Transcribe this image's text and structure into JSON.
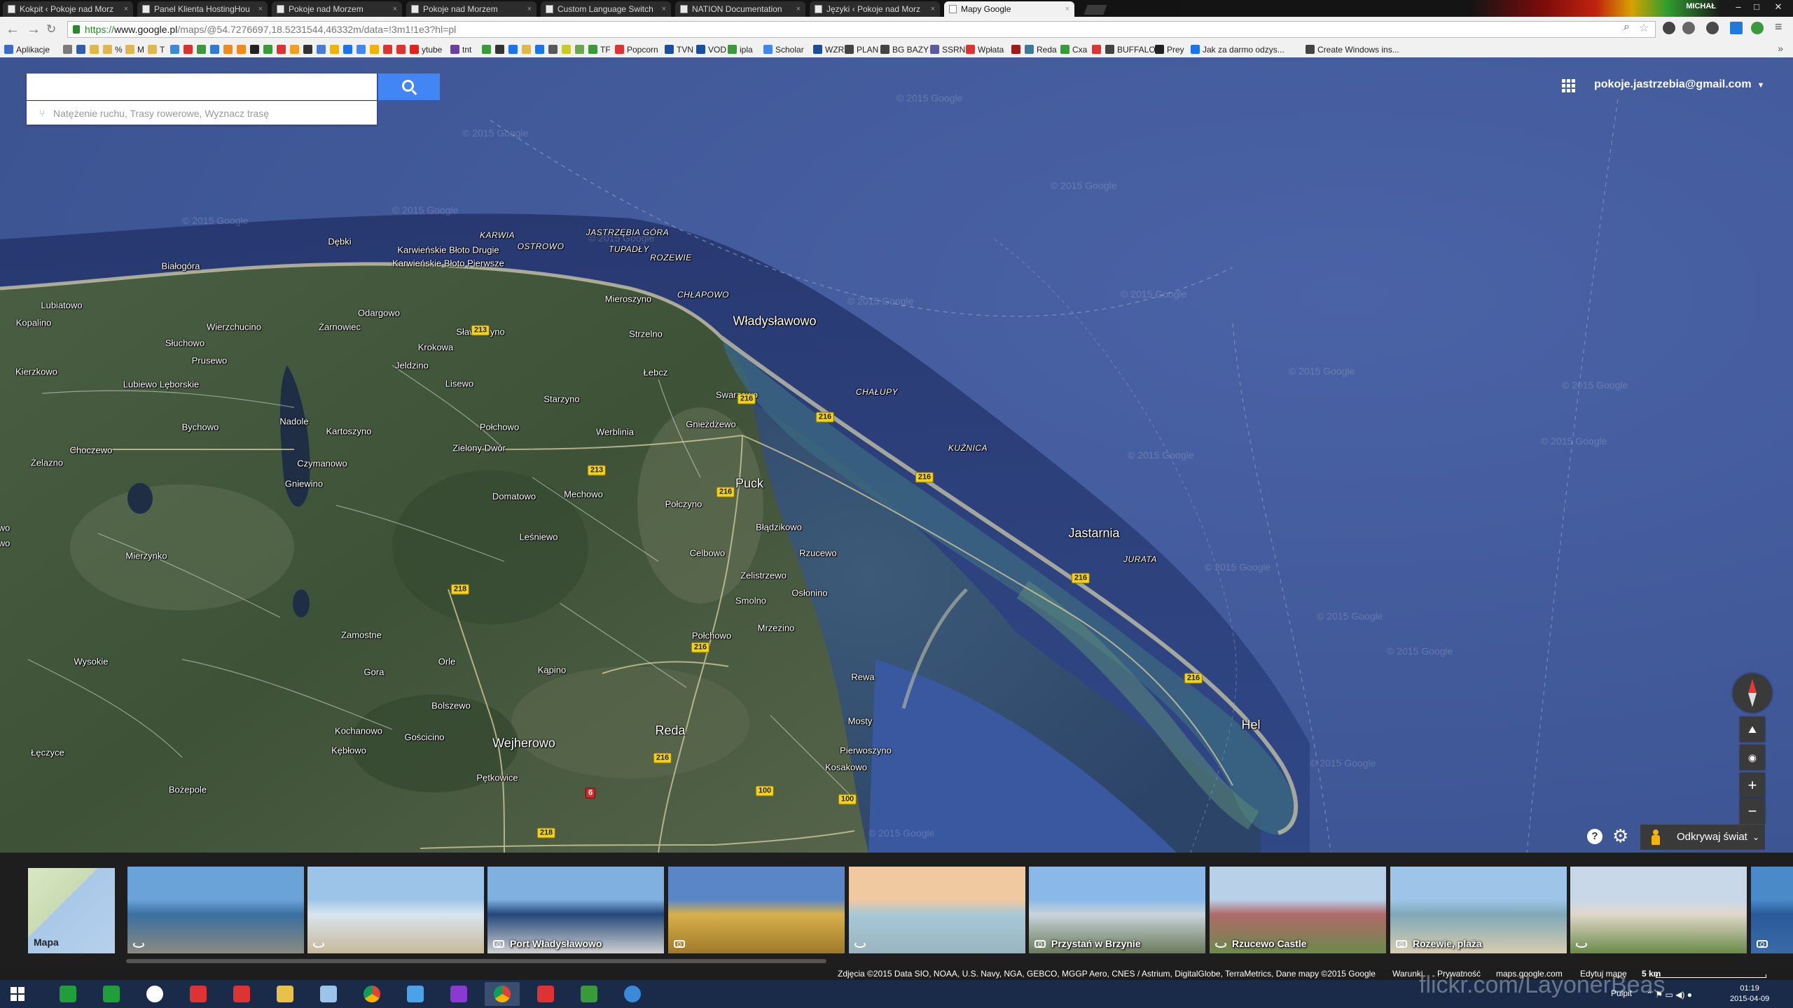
{
  "browser": {
    "tabs": [
      {
        "label": "Kokpit ‹ Pokoje nad Morz",
        "active": false
      },
      {
        "label": "Panel Klienta HostingHou",
        "active": false
      },
      {
        "label": "Pokoje nad Morzem",
        "active": false
      },
      {
        "label": "Pokoje nad Morzem",
        "active": false
      },
      {
        "label": "Custom Language Switch",
        "active": false
      },
      {
        "label": "NATION Documentation",
        "active": false
      },
      {
        "label": "Języki ‹ Pokoje nad Morz",
        "active": false
      },
      {
        "label": "Mapy Google",
        "active": true
      }
    ],
    "window_user": "MICHAŁ",
    "url_scheme": "https://",
    "url_host": "www.google.pl",
    "url_rest": "/maps/@54.7276697,18.5231544,46332m/data=!3m1!1e3?hl=pl",
    "bookmarks": [
      {
        "label": "Aplikacje",
        "color": "#3b6cc9"
      },
      {
        "label": "",
        "color": "#7a7a7a"
      },
      {
        "label": "",
        "color": "#2e5fa8"
      },
      {
        "label": "",
        "color": "#e0b84a"
      },
      {
        "label": "%",
        "color": "#e0b84a"
      },
      {
        "label": "M",
        "color": "#e0b84a"
      },
      {
        "label": "T",
        "color": "#e0b84a"
      },
      {
        "label": "",
        "color": "#3b8ad9"
      },
      {
        "label": "",
        "color": "#d9342b"
      },
      {
        "label": "",
        "color": "#3a9a3a"
      },
      {
        "label": "",
        "color": "#2f7bd2"
      },
      {
        "label": "",
        "color": "#f08a1c"
      },
      {
        "label": "",
        "color": "#f08a1c"
      },
      {
        "label": "",
        "color": "#222222"
      },
      {
        "label": "",
        "color": "#3a9a3a"
      },
      {
        "label": "",
        "color": "#d33"
      },
      {
        "label": "",
        "color": "#f0a020"
      },
      {
        "label": "",
        "color": "#333333"
      },
      {
        "label": "",
        "color": "#4a7bd0"
      },
      {
        "label": "",
        "color": "#f0b400"
      },
      {
        "label": "",
        "color": "#1a73e8"
      },
      {
        "label": "",
        "color": "#4285f4"
      },
      {
        "label": "",
        "color": "#f0b400"
      },
      {
        "label": "",
        "color": "#d33"
      },
      {
        "label": "",
        "color": "#d33"
      },
      {
        "label": "ytube",
        "color": "#e62117"
      },
      {
        "label": "tnt",
        "color": "#6b3fa0"
      },
      {
        "label": "",
        "color": "#3a9a3a"
      },
      {
        "label": "",
        "color": "#333333"
      },
      {
        "label": "",
        "color": "#1a73e8"
      },
      {
        "label": "",
        "color": "#e0b84a"
      },
      {
        "label": "",
        "color": "#1a73e8"
      },
      {
        "label": "",
        "color": "#5a5a5a"
      },
      {
        "label": "",
        "color": "#c9c92a"
      },
      {
        "label": "",
        "color": "#6aa84f"
      },
      {
        "label": "TF",
        "color": "#3a9a3a"
      },
      {
        "label": "Popcorn",
        "color": "#d33"
      },
      {
        "label": "TVN",
        "color": "#1a4fa0"
      },
      {
        "label": "VOD",
        "color": "#1a4fa0"
      },
      {
        "label": "ipla",
        "color": "#3a9a3a"
      },
      {
        "label": "Scholar",
        "color": "#4285f4"
      },
      {
        "label": "WZR",
        "color": "#1a4fa0"
      },
      {
        "label": "PLAN",
        "color": "#444444"
      },
      {
        "label": "BG BAZY",
        "color": "#444444"
      },
      {
        "label": "SSRN",
        "color": "#5a5aa0"
      },
      {
        "label": "Wpłata",
        "color": "#d33"
      },
      {
        "label": "",
        "color": "#a01a1a"
      },
      {
        "label": "Reda",
        "color": "#3a7a9a"
      },
      {
        "label": "Cxa",
        "color": "#3a9a3a"
      },
      {
        "label": "",
        "color": "#d33"
      },
      {
        "label": "BUFFALO",
        "color": "#444444"
      },
      {
        "label": "Prey",
        "color": "#222222"
      },
      {
        "label": "Jak za darmo odzys...",
        "color": "#1a73e8"
      },
      {
        "label": "Create Windows ins...",
        "color": "#444444"
      }
    ],
    "bookmarks_more": "»"
  },
  "maps": {
    "search": {
      "value": "",
      "placeholder": ""
    },
    "suggestion": "Natężenie ruchu, Trasy rowerowe, Wyznacz trasę",
    "account_email": "pokoje.jastrzebia@gmail.com",
    "explore_label": "Odkrywaj świat",
    "watermark": "© 2015 Google",
    "places": [
      {
        "name": "Dębki",
        "kind": "village"
      },
      {
        "name": "Białogóra",
        "kind": "village"
      },
      {
        "name": "Lubiatowo",
        "kind": "village"
      },
      {
        "name": "Kopalino",
        "kind": "village"
      },
      {
        "name": "Karwieńskie Błoto Drugie",
        "kind": "village"
      },
      {
        "name": "Karwieńskie Błoto Pierwsze",
        "kind": "village"
      },
      {
        "name": "KARWIA",
        "kind": "resort"
      },
      {
        "name": "OSTROWO",
        "kind": "resort"
      },
      {
        "name": "JASTRZĘBIA GÓRA",
        "kind": "resort"
      },
      {
        "name": "TUPADŁY",
        "kind": "resort"
      },
      {
        "name": "ROZEWIE",
        "kind": "resort"
      },
      {
        "name": "Mieroszyno",
        "kind": "village"
      },
      {
        "name": "CHŁAPOWO",
        "kind": "resort"
      },
      {
        "name": "Władysławowo",
        "kind": "town"
      },
      {
        "name": "Odargowo",
        "kind": "village"
      },
      {
        "name": "Wierzchucino",
        "kind": "village"
      },
      {
        "name": "Żarnowiec",
        "kind": "village"
      },
      {
        "name": "Sławoszyno",
        "kind": "village"
      },
      {
        "name": "Strzelno",
        "kind": "village"
      },
      {
        "name": "Słuchowo",
        "kind": "village"
      },
      {
        "name": "Krokowa",
        "kind": "village"
      },
      {
        "name": "Prusewo",
        "kind": "village"
      },
      {
        "name": "Jeldzino",
        "kind": "village"
      },
      {
        "name": "Łebcz",
        "kind": "village"
      },
      {
        "name": "CHAŁUPY",
        "kind": "resort"
      },
      {
        "name": "Kierzkowo",
        "kind": "village"
      },
      {
        "name": "Lubiewo Lęborskie",
        "kind": "village"
      },
      {
        "name": "Lisewo",
        "kind": "village"
      },
      {
        "name": "Starzyno",
        "kind": "village"
      },
      {
        "name": "Swarzewo",
        "kind": "village"
      },
      {
        "name": "Nadole",
        "kind": "village"
      },
      {
        "name": "Bychowo",
        "kind": "village"
      },
      {
        "name": "Kartoszyno",
        "kind": "village"
      },
      {
        "name": "Połchowo",
        "kind": "village"
      },
      {
        "name": "Werblinia",
        "kind": "village"
      },
      {
        "name": "Gnieżdżewo",
        "kind": "village"
      },
      {
        "name": "Choczewo",
        "kind": "village"
      },
      {
        "name": "Zielony Dwór",
        "kind": "village"
      },
      {
        "name": "KUŹNICA",
        "kind": "resort"
      },
      {
        "name": "Żelazno",
        "kind": "village"
      },
      {
        "name": "Czymanowo",
        "kind": "village"
      },
      {
        "name": "Gniewino",
        "kind": "village"
      },
      {
        "name": "Puck",
        "kind": "town"
      },
      {
        "name": "Domatowo",
        "kind": "village"
      },
      {
        "name": "Mechowo",
        "kind": "village"
      },
      {
        "name": "Połczyno",
        "kind": "village"
      },
      {
        "name": "Jastarnia",
        "kind": "town"
      },
      {
        "name": "Błądzikowo",
        "kind": "village"
      },
      {
        "name": "Leśniewo",
        "kind": "village"
      },
      {
        "name": "Mierzynko",
        "kind": "village"
      },
      {
        "name": "Celbowo",
        "kind": "village"
      },
      {
        "name": "Rzucewo",
        "kind": "village"
      },
      {
        "name": "JURATA",
        "kind": "resort"
      },
      {
        "name": "Zelistrzewo",
        "kind": "village"
      },
      {
        "name": "Osłonino",
        "kind": "village"
      },
      {
        "name": "Smolno",
        "kind": "village"
      },
      {
        "name": "Mrzezino",
        "kind": "village"
      },
      {
        "name": "Zamostne",
        "kind": "village"
      },
      {
        "name": "Połchowo",
        "kind": "village"
      },
      {
        "name": "Wysokie",
        "kind": "village"
      },
      {
        "name": "Orle",
        "kind": "village"
      },
      {
        "name": "Gora",
        "kind": "village"
      },
      {
        "name": "Kąpino",
        "kind": "village"
      },
      {
        "name": "Rewa",
        "kind": "village"
      },
      {
        "name": "Bolszewo",
        "kind": "village"
      },
      {
        "name": "Mosty",
        "kind": "village"
      },
      {
        "name": "Hel",
        "kind": "town"
      },
      {
        "name": "Kochanowo",
        "kind": "village"
      },
      {
        "name": "Gościcino",
        "kind": "village"
      },
      {
        "name": "Wejherowo",
        "kind": "town"
      },
      {
        "name": "Reda",
        "kind": "town"
      },
      {
        "name": "Pierwoszyno",
        "kind": "village"
      },
      {
        "name": "Łęczyce",
        "kind": "village"
      },
      {
        "name": "Kębłowo",
        "kind": "village"
      },
      {
        "name": "Kosakowo",
        "kind": "village"
      },
      {
        "name": "Pętkowice",
        "kind": "village"
      },
      {
        "name": "Bożepole",
        "kind": "village"
      },
      {
        "name": "wo",
        "kind": "village"
      },
      {
        "name": "wo",
        "kind": "village"
      }
    ],
    "road_shields": [
      {
        "label": "216",
        "color": "yellow"
      },
      {
        "label": "216",
        "color": "yellow"
      },
      {
        "label": "216",
        "color": "yellow"
      },
      {
        "label": "216",
        "color": "yellow"
      },
      {
        "label": "216",
        "color": "yellow"
      },
      {
        "label": "216",
        "color": "yellow"
      },
      {
        "label": "216",
        "color": "yellow"
      },
      {
        "label": "216",
        "color": "yellow"
      },
      {
        "label": "213",
        "color": "yellow"
      },
      {
        "label": "213",
        "color": "yellow"
      },
      {
        "label": "218",
        "color": "yellow"
      },
      {
        "label": "218",
        "color": "yellow"
      },
      {
        "label": "100",
        "color": "yellow"
      },
      {
        "label": "100",
        "color": "yellow"
      },
      {
        "label": "6",
        "color": "red"
      }
    ],
    "controls": {
      "zoom_in": "+",
      "zoom_out": "−",
      "help": "?"
    },
    "filmstrip": [
      {
        "caption": "Mapa",
        "icon": "",
        "colors": [
          "#cfe0b8",
          "#a9c8e8"
        ]
      },
      {
        "caption": "",
        "icon": "pano-icon",
        "colors": [
          "#6aa3d8",
          "#3a6fa0",
          "#8a8a80"
        ]
      },
      {
        "caption": "",
        "icon": "pano-icon",
        "colors": [
          "#9cc4e8",
          "#d8e4ee",
          "#c9b99a"
        ]
      },
      {
        "caption": "Port Władysławowo",
        "icon": "camera-icon",
        "colors": [
          "#7fb0e0",
          "#24477a",
          "#d0d0d0"
        ]
      },
      {
        "caption": "",
        "icon": "camera-icon",
        "colors": [
          "#5a86c8",
          "#d8b04a",
          "#a07a2a"
        ]
      },
      {
        "caption": "",
        "icon": "pano-icon",
        "colors": [
          "#f0c9a0",
          "#a8c8d8",
          "#9ab4c0"
        ]
      },
      {
        "caption": "Przystań w Brzynie",
        "icon": "camera-icon",
        "colors": [
          "#8ab8e8",
          "#c8d4da",
          "#6a7a5a"
        ]
      },
      {
        "caption": "Rzucewo Castle",
        "icon": "pano-icon",
        "colors": [
          "#b8d0e8",
          "#b06a6a",
          "#6a8a4a"
        ]
      },
      {
        "caption": "Rozewie, plaża",
        "icon": "camera-icon",
        "colors": [
          "#9ec4e8",
          "#7fa8b8",
          "#d8ccb0"
        ]
      },
      {
        "caption": "",
        "icon": "pano-icon",
        "colors": [
          "#c8d8e8",
          "#e0d8c8",
          "#6a8a4a"
        ]
      },
      {
        "caption": "",
        "icon": "camera-icon",
        "colors": [
          "#4a8ac8",
          "#2a5a9a",
          "#3a6aa8"
        ]
      }
    ],
    "attribution": "Zdjęcia ©2015 Data SIO, NOAA, U.S. Navy, NGA, GEBCO, MGGP Aero, CNES / Astrium, DigitalGlobe, TerraMetrics, Dane mapy ©2015 Google",
    "links": [
      "Warunki",
      "Prywatność",
      "maps.google.com",
      "Edytuj mapę"
    ],
    "scale_label": "5 km"
  },
  "taskbar": {
    "apps": [
      {
        "name": "start-icon",
        "color": "#ffffff"
      },
      {
        "name": "store-icon",
        "color": "#1f9e3a"
      },
      {
        "name": "excel-icon",
        "color": "#1f9e3a"
      },
      {
        "name": "onedrive-icon",
        "color": "#ffffff"
      },
      {
        "name": "alarm-icon",
        "color": "#d33"
      },
      {
        "name": "news-icon",
        "color": "#d33"
      },
      {
        "name": "explorer-icon",
        "color": "#e8c04a"
      },
      {
        "name": "note-icon",
        "color": "#9cc4e8"
      },
      {
        "name": "chrome-icon",
        "color": "#e8b400"
      },
      {
        "name": "weather-icon",
        "color": "#4aa3e8"
      },
      {
        "name": "search-app-icon",
        "color": "#8a3ad0"
      },
      {
        "name": "chrome-active-icon",
        "color": "#3a9a3a"
      },
      {
        "name": "tool-icon",
        "color": "#d33"
      },
      {
        "name": "utorrent-icon",
        "color": "#3a9a3a"
      },
      {
        "name": "ie-icon",
        "color": "#3a8ad9"
      }
    ],
    "flickr_watermark": "flickr.com/LayonerBeas",
    "tray_label": "Pulpit",
    "time": "01:19",
    "date": "2015-04-09"
  }
}
